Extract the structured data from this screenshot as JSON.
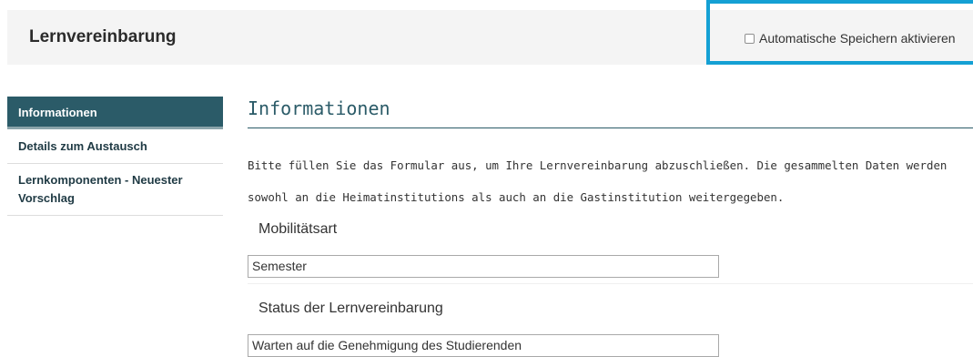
{
  "header": {
    "title": "Lernvereinbarung",
    "autosave_label": "Automatische Speichern aktivieren",
    "autosave_checked": false
  },
  "sidebar": {
    "items": [
      {
        "label": "Informationen",
        "active": true
      },
      {
        "label": "Details zum Austausch",
        "active": false
      },
      {
        "label": "Lernkomponenten - Neuester Vorschlag",
        "active": false
      }
    ]
  },
  "main": {
    "section_title": "Informationen",
    "intro": "Bitte füllen Sie das Formular aus, um Ihre Lernvereinbarung abzuschließen. Die gesammelten Daten werden sowohl an die Heimatinstitutions als auch an die Gastinstitution weitergegeben.",
    "fields": [
      {
        "label": "Mobilitätsart",
        "value": "Semester"
      },
      {
        "label": "Status der Lernvereinbarung",
        "value": "Warten auf die Genehmigung des Studierenden"
      }
    ]
  },
  "colors": {
    "accent": "#2b5b68",
    "highlight": "#14a0d4",
    "topbar_bg": "#f4f4f4"
  }
}
